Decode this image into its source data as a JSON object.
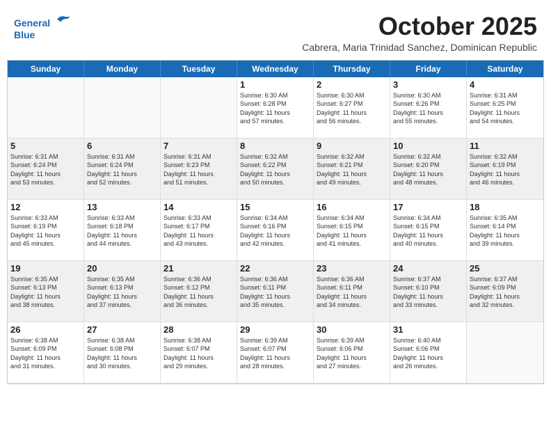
{
  "logo": {
    "line1": "General",
    "line2": "Blue"
  },
  "title": "October 2025",
  "location": "Cabrera, Maria Trinidad Sanchez, Dominican Republic",
  "days_of_week": [
    "Sunday",
    "Monday",
    "Tuesday",
    "Wednesday",
    "Thursday",
    "Friday",
    "Saturday"
  ],
  "weeks": [
    [
      {
        "day": "",
        "info": ""
      },
      {
        "day": "",
        "info": ""
      },
      {
        "day": "",
        "info": ""
      },
      {
        "day": "1",
        "info": "Sunrise: 6:30 AM\nSunset: 6:28 PM\nDaylight: 11 hours\nand 57 minutes."
      },
      {
        "day": "2",
        "info": "Sunrise: 6:30 AM\nSunset: 6:27 PM\nDaylight: 11 hours\nand 56 minutes."
      },
      {
        "day": "3",
        "info": "Sunrise: 6:30 AM\nSunset: 6:26 PM\nDaylight: 11 hours\nand 55 minutes."
      },
      {
        "day": "4",
        "info": "Sunrise: 6:31 AM\nSunset: 6:25 PM\nDaylight: 11 hours\nand 54 minutes."
      }
    ],
    [
      {
        "day": "5",
        "info": "Sunrise: 6:31 AM\nSunset: 6:24 PM\nDaylight: 11 hours\nand 53 minutes."
      },
      {
        "day": "6",
        "info": "Sunrise: 6:31 AM\nSunset: 6:24 PM\nDaylight: 11 hours\nand 52 minutes."
      },
      {
        "day": "7",
        "info": "Sunrise: 6:31 AM\nSunset: 6:23 PM\nDaylight: 11 hours\nand 51 minutes."
      },
      {
        "day": "8",
        "info": "Sunrise: 6:32 AM\nSunset: 6:22 PM\nDaylight: 11 hours\nand 50 minutes."
      },
      {
        "day": "9",
        "info": "Sunrise: 6:32 AM\nSunset: 6:21 PM\nDaylight: 11 hours\nand 49 minutes."
      },
      {
        "day": "10",
        "info": "Sunrise: 6:32 AM\nSunset: 6:20 PM\nDaylight: 11 hours\nand 48 minutes."
      },
      {
        "day": "11",
        "info": "Sunrise: 6:32 AM\nSunset: 6:19 PM\nDaylight: 11 hours\nand 46 minutes."
      }
    ],
    [
      {
        "day": "12",
        "info": "Sunrise: 6:33 AM\nSunset: 6:19 PM\nDaylight: 11 hours\nand 45 minutes."
      },
      {
        "day": "13",
        "info": "Sunrise: 6:33 AM\nSunset: 6:18 PM\nDaylight: 11 hours\nand 44 minutes."
      },
      {
        "day": "14",
        "info": "Sunrise: 6:33 AM\nSunset: 6:17 PM\nDaylight: 11 hours\nand 43 minutes."
      },
      {
        "day": "15",
        "info": "Sunrise: 6:34 AM\nSunset: 6:16 PM\nDaylight: 11 hours\nand 42 minutes."
      },
      {
        "day": "16",
        "info": "Sunrise: 6:34 AM\nSunset: 6:15 PM\nDaylight: 11 hours\nand 41 minutes."
      },
      {
        "day": "17",
        "info": "Sunrise: 6:34 AM\nSunset: 6:15 PM\nDaylight: 11 hours\nand 40 minutes."
      },
      {
        "day": "18",
        "info": "Sunrise: 6:35 AM\nSunset: 6:14 PM\nDaylight: 11 hours\nand 39 minutes."
      }
    ],
    [
      {
        "day": "19",
        "info": "Sunrise: 6:35 AM\nSunset: 6:13 PM\nDaylight: 11 hours\nand 38 minutes."
      },
      {
        "day": "20",
        "info": "Sunrise: 6:35 AM\nSunset: 6:13 PM\nDaylight: 11 hours\nand 37 minutes."
      },
      {
        "day": "21",
        "info": "Sunrise: 6:36 AM\nSunset: 6:12 PM\nDaylight: 11 hours\nand 36 minutes."
      },
      {
        "day": "22",
        "info": "Sunrise: 6:36 AM\nSunset: 6:11 PM\nDaylight: 11 hours\nand 35 minutes."
      },
      {
        "day": "23",
        "info": "Sunrise: 6:36 AM\nSunset: 6:11 PM\nDaylight: 11 hours\nand 34 minutes."
      },
      {
        "day": "24",
        "info": "Sunrise: 6:37 AM\nSunset: 6:10 PM\nDaylight: 11 hours\nand 33 minutes."
      },
      {
        "day": "25",
        "info": "Sunrise: 6:37 AM\nSunset: 6:09 PM\nDaylight: 11 hours\nand 32 minutes."
      }
    ],
    [
      {
        "day": "26",
        "info": "Sunrise: 6:38 AM\nSunset: 6:09 PM\nDaylight: 11 hours\nand 31 minutes."
      },
      {
        "day": "27",
        "info": "Sunrise: 6:38 AM\nSunset: 6:08 PM\nDaylight: 11 hours\nand 30 minutes."
      },
      {
        "day": "28",
        "info": "Sunrise: 6:38 AM\nSunset: 6:07 PM\nDaylight: 11 hours\nand 29 minutes."
      },
      {
        "day": "29",
        "info": "Sunrise: 6:39 AM\nSunset: 6:07 PM\nDaylight: 11 hours\nand 28 minutes."
      },
      {
        "day": "30",
        "info": "Sunrise: 6:39 AM\nSunset: 6:06 PM\nDaylight: 11 hours\nand 27 minutes."
      },
      {
        "day": "31",
        "info": "Sunrise: 6:40 AM\nSunset: 6:06 PM\nDaylight: 11 hours\nand 26 minutes."
      },
      {
        "day": "",
        "info": ""
      }
    ]
  ]
}
